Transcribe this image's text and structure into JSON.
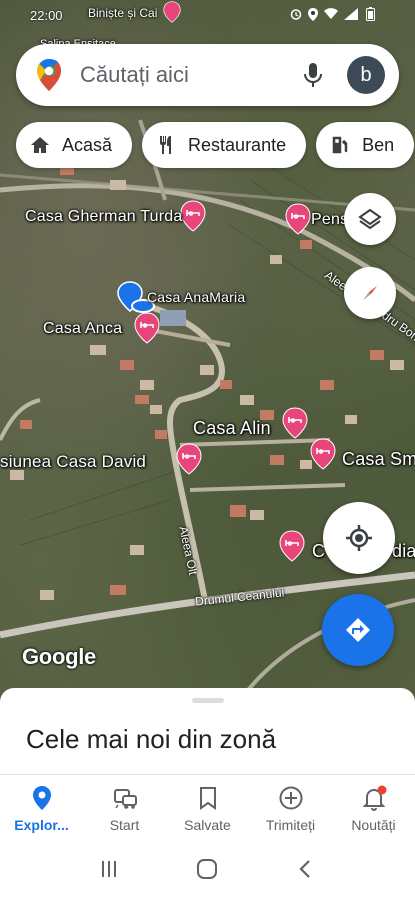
{
  "status_bar": {
    "time": "22:00"
  },
  "search": {
    "placeholder": "Căutați aici",
    "avatar_letter": "b"
  },
  "chips": [
    {
      "label": "Acasă",
      "icon": "home-icon"
    },
    {
      "label": "Restaurante",
      "icon": "fork-knife-icon"
    },
    {
      "label": "Ben",
      "icon": "gas-station-icon"
    }
  ],
  "map": {
    "pois": [
      {
        "name": "Casa Gherman Turda"
      },
      {
        "name": "Pens"
      },
      {
        "name": "Casa AnaMaria"
      },
      {
        "name": "Casa Anca"
      },
      {
        "name": "Casa Alin"
      },
      {
        "name": "siunea Casa David"
      },
      {
        "name": "Casa Sm"
      },
      {
        "name": "C"
      },
      {
        "name": "dia"
      }
    ],
    "roads": [
      {
        "name": "Biniște și Cai"
      },
      {
        "name": "Aleea Olt"
      },
      {
        "name": "Drumul Ceanului"
      },
      {
        "name": "Aleea Alexandru Borza"
      },
      {
        "name": "Salina Ensitace"
      }
    ],
    "attribution": "Google"
  },
  "sheet": {
    "title": "Cele mai noi din zonă"
  },
  "bottom_nav": [
    {
      "label": "Explor...",
      "icon": "explore-pin-icon",
      "active": true
    },
    {
      "label": "Start",
      "icon": "commute-icon",
      "active": false
    },
    {
      "label": "Salvate",
      "icon": "bookmark-icon",
      "active": false
    },
    {
      "label": "Trimiteți",
      "icon": "add-circle-icon",
      "active": false
    },
    {
      "label": "Noutăți",
      "icon": "bell-icon",
      "active": false
    }
  ],
  "colors": {
    "accent": "#1a73e8",
    "poi_pin": "#e8457a",
    "notification_dot": "#ea4335"
  }
}
